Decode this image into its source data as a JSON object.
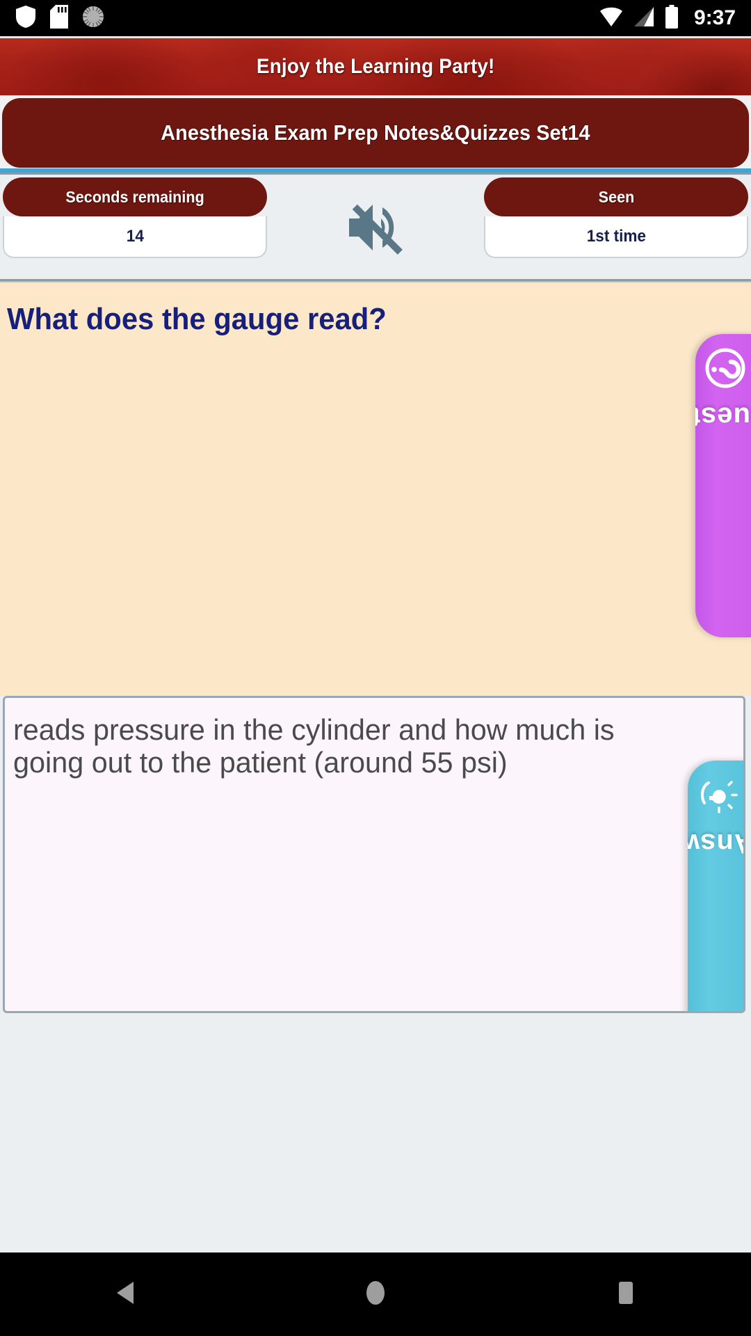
{
  "statusbar": {
    "time": "9:37",
    "icons": [
      "shield-icon",
      "sd-card-icon",
      "sync-circle-icon",
      "wifi-icon",
      "cellular-signal-icon",
      "battery-icon"
    ]
  },
  "banner": {
    "text": "Enjoy the Learning Party!"
  },
  "title": {
    "text": "Anesthesia Exam Prep Notes&Quizzes Set14"
  },
  "strip": {
    "timer_label": "Seconds remaining",
    "timer_value": "14",
    "mute_icon": "speaker-muted-icon",
    "seen_label": "Seen",
    "seen_value": "1st time"
  },
  "question": {
    "tab_label": "Question",
    "tab_icon": "question-mark-circle-icon",
    "text": "What does the gauge read?"
  },
  "answer": {
    "tab_label": "Answer",
    "tab_icon": "lightbulb-in-hand-icon",
    "text": "reads pressure in the cylinder and how much is going out to the patient (around 55 psi)"
  },
  "navbar": {
    "back_label": "back-triangle-icon",
    "home_label": "home-circle-icon",
    "recents_label": "recents-square-icon"
  },
  "colors": {
    "banner_red": "#a82218",
    "title_maroon": "#6E1710",
    "divider_blue": "#3BA6D8",
    "question_bg": "#FCE8C9",
    "question_text": "#16207A",
    "question_tab": "#CE5DEC",
    "answer_tab": "#59C3DB",
    "answer_bg": "#FCF6FC",
    "mute_icon": "#5A7788"
  }
}
